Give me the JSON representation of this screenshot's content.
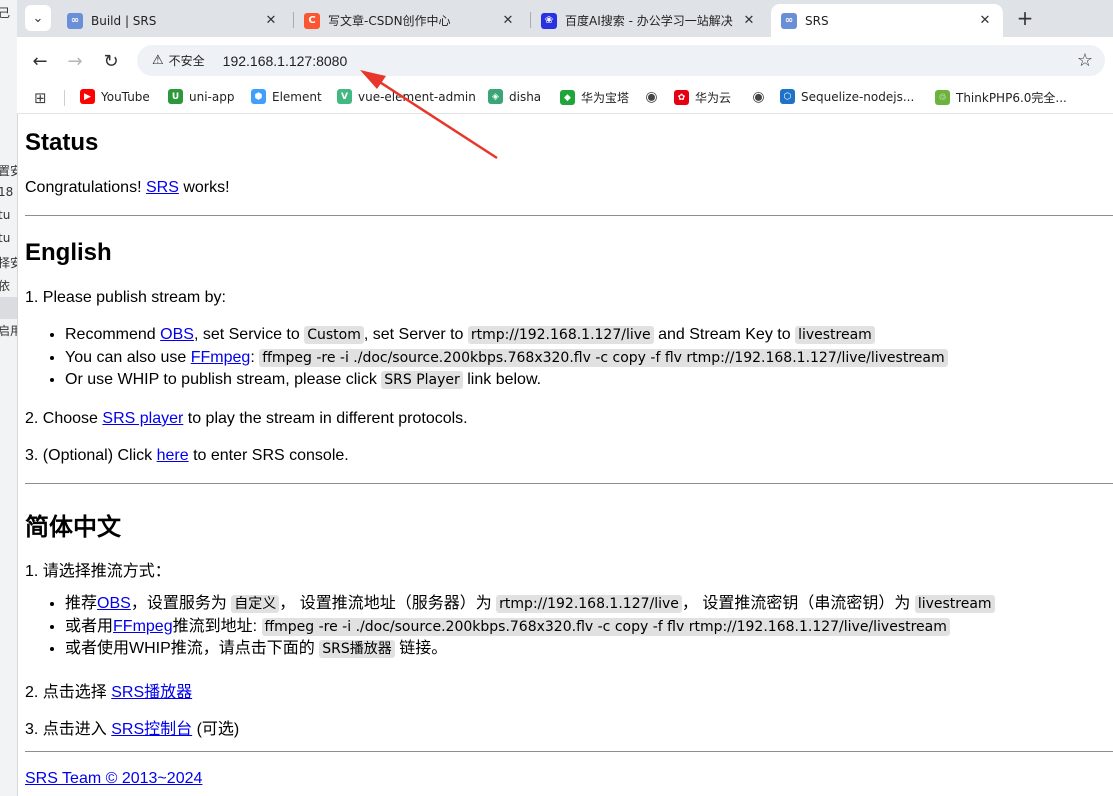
{
  "left_strip": {
    "items": [
      "己",
      "置安",
      "18",
      "tu",
      "tu",
      "择安",
      "依",
      "启用"
    ]
  },
  "tabs": [
    {
      "title": "Build | SRS",
      "active": false,
      "icon": "srs-favicon"
    },
    {
      "title": "写文章-CSDN创作中心",
      "active": false,
      "icon": "csdn-favicon"
    },
    {
      "title": "百度AI搜索 - 办公学习一站解决",
      "active": false,
      "icon": "baidu-favicon"
    },
    {
      "title": "SRS",
      "active": true,
      "icon": "srs-favicon"
    }
  ],
  "toolbar": {
    "security_label": "不安全",
    "url": "192.168.1.127:8080"
  },
  "bookmarks": [
    {
      "label": "YouTube",
      "color": "#ff0000",
      "glyph": "▶"
    },
    {
      "label": "uni-app",
      "color": "#2b9939",
      "glyph": "U"
    },
    {
      "label": "Element",
      "color": "#409eff",
      "glyph": "⬢"
    },
    {
      "label": "vue-element-admin",
      "color": "#42b883",
      "glyph": "V"
    },
    {
      "label": "disha",
      "color": "#3aa675",
      "glyph": "◈"
    },
    {
      "label": "华为宝塔",
      "color": "#20a53a",
      "glyph": "◆"
    },
    {
      "label": "",
      "color": "#444444",
      "glyph": "◉"
    },
    {
      "label": "华为云",
      "color": "#e60012",
      "glyph": "✿"
    },
    {
      "label": "",
      "color": "#444444",
      "glyph": "◉"
    },
    {
      "label": "Sequelize-nodejs...",
      "color": "#1e72c8",
      "glyph": "⬡"
    },
    {
      "label": "ThinkPHP6.0完全...",
      "color": "#6cb33e",
      "glyph": "♲"
    }
  ],
  "status": {
    "heading": "Status",
    "congrats_prefix": "Congratulations! ",
    "congrats_link": "SRS",
    "congrats_suffix": " works!"
  },
  "english": {
    "heading": "English",
    "step1": "1. Please publish stream by:",
    "b1": {
      "t1": "Recommend ",
      "l1": "OBS",
      "t2": ", set Service to ",
      "c1": "Custom",
      "t3": ", set Server to ",
      "c2": "rtmp://192.168.1.127/live",
      "t4": " and Stream Key to ",
      "c3": "livestream"
    },
    "b2": {
      "t1": "You can also use ",
      "l1": "FFmpeg",
      "t2": ": ",
      "c1": "ffmpeg -re -i ./doc/source.200kbps.768x320.flv -c copy -f flv rtmp://192.168.1.127/live/livestream"
    },
    "b3": {
      "t1": "Or use WHIP to publish stream, please click ",
      "c1": "SRS Player",
      "t2": " link below."
    },
    "step2": {
      "t1": "2. Choose ",
      "l1": "SRS player",
      "t2": " to play the stream in different protocols."
    },
    "step3": {
      "t1": "3. (Optional) Click ",
      "l1": "here",
      "t2": " to enter SRS console."
    }
  },
  "chinese": {
    "heading": "简体中文",
    "step1": "1. 请选择推流方式：",
    "b1": {
      "t1": "推荐",
      "l1": "OBS",
      "t2": "，设置服务为 ",
      "c1": "自定义",
      "t3": "， 设置推流地址（服务器）为 ",
      "c2": "rtmp://192.168.1.127/live",
      "t4": "， 设置推流密钥（串流密钥）为 ",
      "c3": "livestream"
    },
    "b2": {
      "t1": "或者用",
      "l1": "FFmpeg",
      "t2": "推流到地址: ",
      "c1": "ffmpeg -re -i ./doc/source.200kbps.768x320.flv -c copy -f flv rtmp://192.168.1.127/live/livestream"
    },
    "b3": {
      "t1": "或者使用WHIP推流，请点击下面的 ",
      "c1": "SRS播放器",
      "t2": " 链接。"
    },
    "step2": {
      "t1": "2. 点击选择 ",
      "l1": "SRS播放器"
    },
    "step3": {
      "t1": "3. 点击进入 ",
      "l1": "SRS控制台",
      "t2": " (可选)"
    }
  },
  "footer": {
    "link": "SRS Team © 2013~2024"
  },
  "colors": {
    "link": "#0000ee",
    "annotation_arrow": "#e8372a",
    "tab_bar": "#dfe3e8"
  }
}
